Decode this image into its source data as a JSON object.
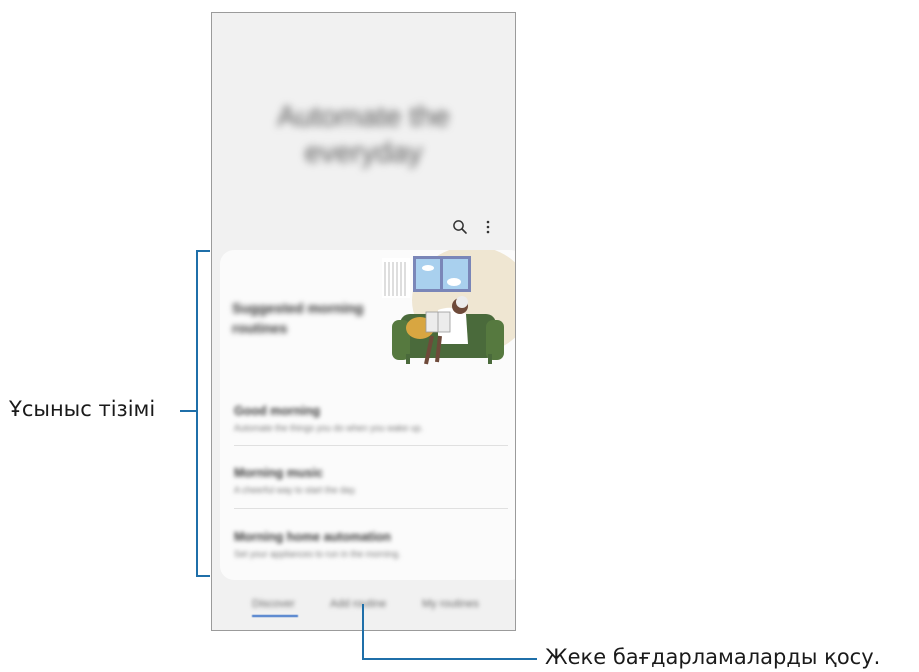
{
  "screen": {
    "hero_title_line1": "Automate the",
    "hero_title_line2": "everyday",
    "icons": {
      "search": "search-icon",
      "more": "more-vert-icon"
    }
  },
  "card": {
    "title": "Suggested morning routines",
    "routines": [
      {
        "name": "Good morning",
        "desc": "Automate the things you do when you wake up."
      },
      {
        "name": "Morning music",
        "desc": "A cheerful way to start the day."
      },
      {
        "name": "Morning home automation",
        "desc": "Set your appliances to run in the morning."
      }
    ]
  },
  "tabs": {
    "discover": "Discover",
    "add_routine": "Add routine",
    "my_routines": "My routines"
  },
  "annotations": {
    "suggestion_list": "Ұсыныс тізімі",
    "add_custom": "Жеке бағдарламаларды қосу."
  },
  "colors": {
    "callout": "#1f6fa9",
    "accent": "#3a72c9",
    "sofa": "#4a6a3b"
  }
}
